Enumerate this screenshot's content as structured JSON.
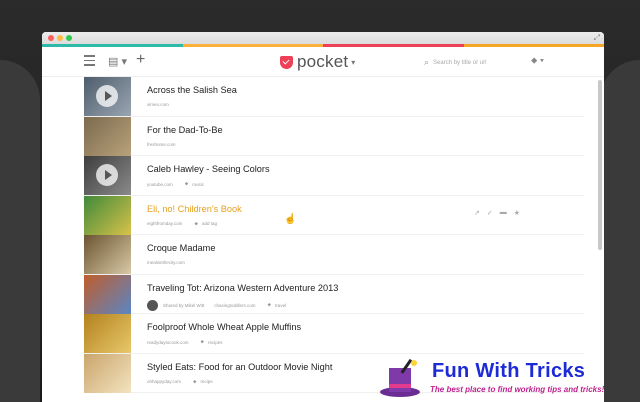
{
  "app": {
    "logo_text": "pocket",
    "search_placeholder": "Search by title or url",
    "colors": {
      "accent": "#ee4056",
      "hover_title": "#e8a020",
      "bar": [
        "#2dbaa8",
        "#fbb03b",
        "#ee4056",
        "#f5a623"
      ]
    }
  },
  "items": [
    {
      "title": "Across the Salish Sea",
      "domain": "vimeo.com",
      "tag": "",
      "thumb": [
        "#4e5d6c",
        "#9aa5b1"
      ],
      "video": true
    },
    {
      "title": "For the Dad-To-Be",
      "domain": "freshome.com",
      "tag": "",
      "thumb": [
        "#7b6a4f",
        "#b9a27a"
      ],
      "video": false
    },
    {
      "title": "Caleb Hawley - Seeing Colors",
      "domain": "youtube.com",
      "tag": "music",
      "thumb": [
        "#3e3e3e",
        "#8a8a8a"
      ],
      "video": true
    },
    {
      "title": "Eli, no! Children's Book",
      "domain": "eightfromday.com",
      "tag": "add tag",
      "thumb": [
        "#3f8a3a",
        "#d9c24a"
      ],
      "video": false,
      "hover": true
    },
    {
      "title": "Croque Madame",
      "domain": "mealsinthecity.com",
      "tag": "",
      "thumb": [
        "#6b5431",
        "#d9c9a6"
      ],
      "video": false
    },
    {
      "title": "Traveling Tot: Arizona Western Adventure 2013",
      "domain": "chasingtoddlers.com",
      "tag": "travel",
      "shared": "Shared by Mikel Witt",
      "thumb": [
        "#c05d2b",
        "#5a86c4"
      ],
      "video": false
    },
    {
      "title": "Foolproof Whole Wheat Apple Muffins",
      "domain": "readydaytocook.com",
      "tag": "recipes",
      "thumb": [
        "#b3811e",
        "#e8c86a"
      ],
      "video": false
    },
    {
      "title": "Styled Eats: Food for an Outdoor Movie Night",
      "domain": "ohhappyday.com",
      "tag": "recipe",
      "thumb": [
        "#caa56b",
        "#f3e3c0"
      ],
      "video": false
    }
  ],
  "watermark": {
    "title": "Fun With Tricks",
    "subtitle": "The best place to find working tips and tricks!"
  }
}
